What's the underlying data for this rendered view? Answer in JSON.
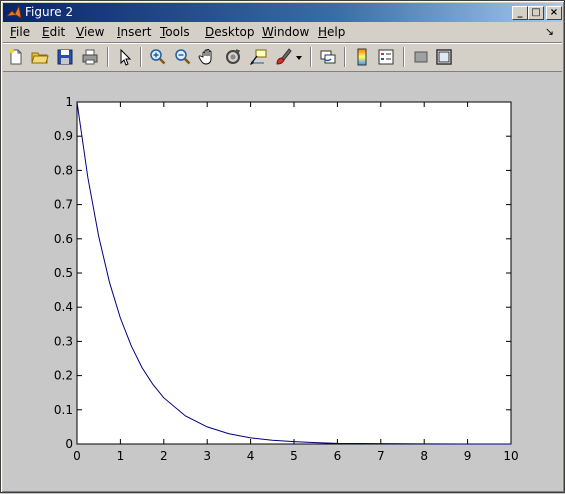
{
  "window": {
    "title": "Figure 2"
  },
  "title_buttons": {
    "minimize": "_",
    "maximize": "□",
    "close": "×"
  },
  "menu": [
    {
      "label": "File",
      "mnemonic": "F",
      "rest": "ile"
    },
    {
      "label": "Edit",
      "mnemonic": "E",
      "rest": "dit"
    },
    {
      "label": "View",
      "mnemonic": "V",
      "rest": "iew"
    },
    {
      "label": "Insert",
      "mnemonic": "I",
      "rest": "nsert"
    },
    {
      "label": "Tools",
      "mnemonic": "T",
      "rest": "ools"
    },
    {
      "label": "Desktop",
      "mnemonic": "D",
      "rest": "esktop"
    },
    {
      "label": "Window",
      "mnemonic": "W",
      "rest": "indow"
    },
    {
      "label": "Help",
      "mnemonic": "H",
      "rest": "elp"
    }
  ],
  "menu_arrow": "↘",
  "toolbar_icons": [
    "new-figure-icon",
    "open-file-icon",
    "save-icon",
    "print-icon",
    "edit-plot-arrow-icon",
    "zoom-in-icon",
    "zoom-out-icon",
    "pan-hand-icon",
    "rotate-3d-icon",
    "data-cursor-icon",
    "brush-icon",
    "brush-dropdown-icon",
    "link-plot-icon",
    "insert-colorbar-icon",
    "insert-legend-icon",
    "hide-plot-tools-icon",
    "show-plot-tools-icon"
  ],
  "chart_data": {
    "type": "line",
    "title": "",
    "xlabel": "",
    "ylabel": "",
    "xlim": [
      0,
      10
    ],
    "ylim": [
      0,
      1
    ],
    "xticks": [
      "0",
      "1",
      "2",
      "3",
      "4",
      "5",
      "6",
      "7",
      "8",
      "9",
      "10"
    ],
    "yticks": [
      "0",
      "0.1",
      "0.2",
      "0.3",
      "0.4",
      "0.5",
      "0.6",
      "0.7",
      "0.8",
      "0.9",
      "1"
    ],
    "grid": false,
    "series": [
      {
        "color": "#00007f",
        "x": [
          0,
          0.25,
          0.5,
          0.75,
          1,
          1.25,
          1.5,
          1.75,
          2,
          2.5,
          3,
          3.5,
          4,
          4.5,
          5,
          5.5,
          6,
          7,
          8,
          9,
          10
        ],
        "y": [
          1,
          0.779,
          0.607,
          0.472,
          0.368,
          0.287,
          0.223,
          0.174,
          0.135,
          0.082,
          0.05,
          0.03,
          0.018,
          0.011,
          0.007,
          0.004,
          0.002,
          0.001,
          0.0003,
          0.0001,
          5e-05
        ]
      }
    ]
  }
}
